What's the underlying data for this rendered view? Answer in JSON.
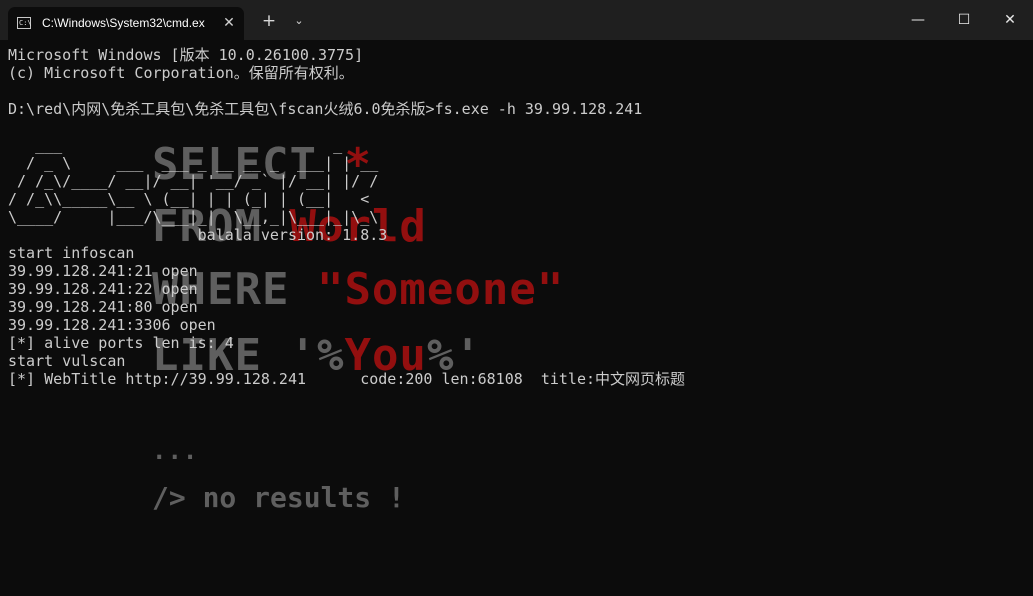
{
  "tab": {
    "title": "C:\\Windows\\System32\\cmd.ex",
    "icon": "cmd-icon",
    "close_label": "✕",
    "new_tab_label": "+",
    "dropdown_label": "⌄"
  },
  "window_controls": {
    "minimize": "—",
    "maximize": "☐",
    "close": "✕"
  },
  "terminal": {
    "lines": [
      "Microsoft Windows [版本 10.0.26100.3775]",
      "(c) Microsoft Corporation。保留所有权利。",
      "",
      "D:\\red\\内网\\免杀工具包\\免杀工具包\\fscan火绒6.0免杀版>fs.exe -h 39.99.128.241",
      "",
      "   ___                              _",
      "  / _ \\     ___  ___ _ __ __ _  ___| | __",
      " / /_\\/____/ __|/ __| '__/ _` |/ __| |/ /",
      "/ /_\\\\_____\\__ \\ (__| | | (_| | (__|   <",
      "\\____/     |___/\\___|_|  \\__,_|\\___|_|\\_\\",
      "                     balala version: 1.8.3",
      "start infoscan",
      "39.99.128.241:21 open",
      "39.99.128.241:22 open",
      "39.99.128.241:80 open",
      "39.99.128.241:3306 open",
      "[*] alive ports len is: 4",
      "start vulscan",
      "[*] WebTitle http://39.99.128.241      code:200 len:68108  title:中文网页标题"
    ]
  },
  "overlay": {
    "select_word": "SELECT",
    "select_star": "*",
    "from_word": "FROM",
    "from_target": "World",
    "where_word": "WHERE",
    "where_target": "\"Someone\"",
    "like_word": "LIKE",
    "like_open": "'%",
    "like_target": "You",
    "like_close": "%'",
    "dots": "...",
    "no_results": "/> no results !"
  },
  "colors": {
    "background": "#0c0c0c",
    "titlebar": "#1f1f1f",
    "text": "#cccccc",
    "overlay_gray": "#808080",
    "overlay_red": "#c81010"
  }
}
